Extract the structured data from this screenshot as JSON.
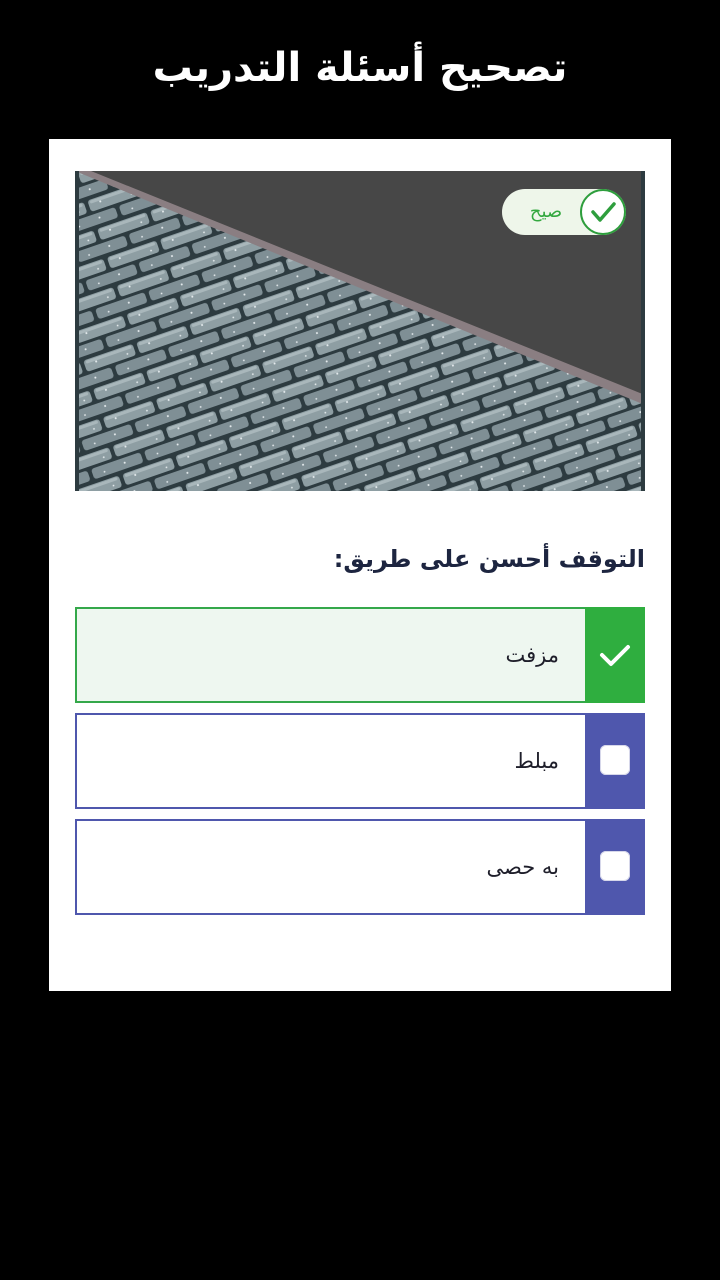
{
  "header": {
    "title": "تصحيح أسئلة التدريب"
  },
  "result": {
    "label": "صيح",
    "status_color": "#2e9e3d"
  },
  "question": {
    "text": "التوقف أحسن على طريق:",
    "options": [
      {
        "label": "مزفت",
        "state": "correct",
        "icon": "checkmark-icon"
      },
      {
        "label": "مبلط",
        "state": "unselected",
        "icon": "checkbox-icon"
      },
      {
        "label": "به حصى",
        "state": "unselected",
        "icon": "checkbox-icon"
      }
    ]
  },
  "colors": {
    "correct": "#2fae3f",
    "option_accent": "#4f57ad",
    "background": "#000000"
  },
  "illustration": {
    "subject": "paved-brick-road-icon"
  }
}
